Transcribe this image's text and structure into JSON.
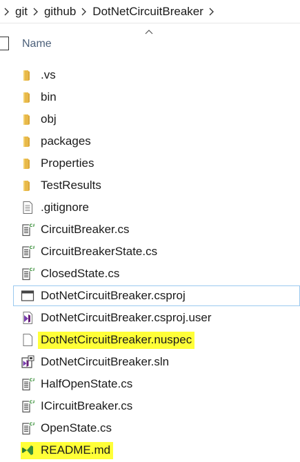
{
  "breadcrumb": [
    "git",
    "github",
    "DotNetCircuitBreaker"
  ],
  "header": {
    "name_column": "Name"
  },
  "files": [
    {
      "name": ".vs",
      "icon": "folder-icon"
    },
    {
      "name": "bin",
      "icon": "folder-icon"
    },
    {
      "name": "obj",
      "icon": "folder-icon"
    },
    {
      "name": "packages",
      "icon": "folder-icon"
    },
    {
      "name": "Properties",
      "icon": "folder-icon"
    },
    {
      "name": "TestResults",
      "icon": "folder-icon"
    },
    {
      "name": ".gitignore",
      "icon": "text-file-icon"
    },
    {
      "name": "CircuitBreaker.cs",
      "icon": "csharp-file-icon"
    },
    {
      "name": "CircuitBreakerState.cs",
      "icon": "csharp-file-icon"
    },
    {
      "name": "ClosedState.cs",
      "icon": "csharp-file-icon"
    },
    {
      "name": "DotNetCircuitBreaker.csproj",
      "icon": "csproj-file-icon"
    },
    {
      "name": "DotNetCircuitBreaker.csproj.user",
      "icon": "vs-file-icon"
    },
    {
      "name": "DotNetCircuitBreaker.nuspec",
      "icon": "blank-file-icon"
    },
    {
      "name": "DotNetCircuitBreaker.sln",
      "icon": "sln-file-icon"
    },
    {
      "name": "HalfOpenState.cs",
      "icon": "csharp-file-icon"
    },
    {
      "name": "ICircuitBreaker.cs",
      "icon": "csharp-file-icon"
    },
    {
      "name": "OpenState.cs",
      "icon": "csharp-file-icon"
    },
    {
      "name": "README.md",
      "icon": "vscode-file-icon"
    }
  ],
  "colors": {
    "highlight": "#ffff38",
    "folder": "#e8b94a",
    "selection_border": "#99c9ef",
    "column_header": "#4c607a"
  }
}
